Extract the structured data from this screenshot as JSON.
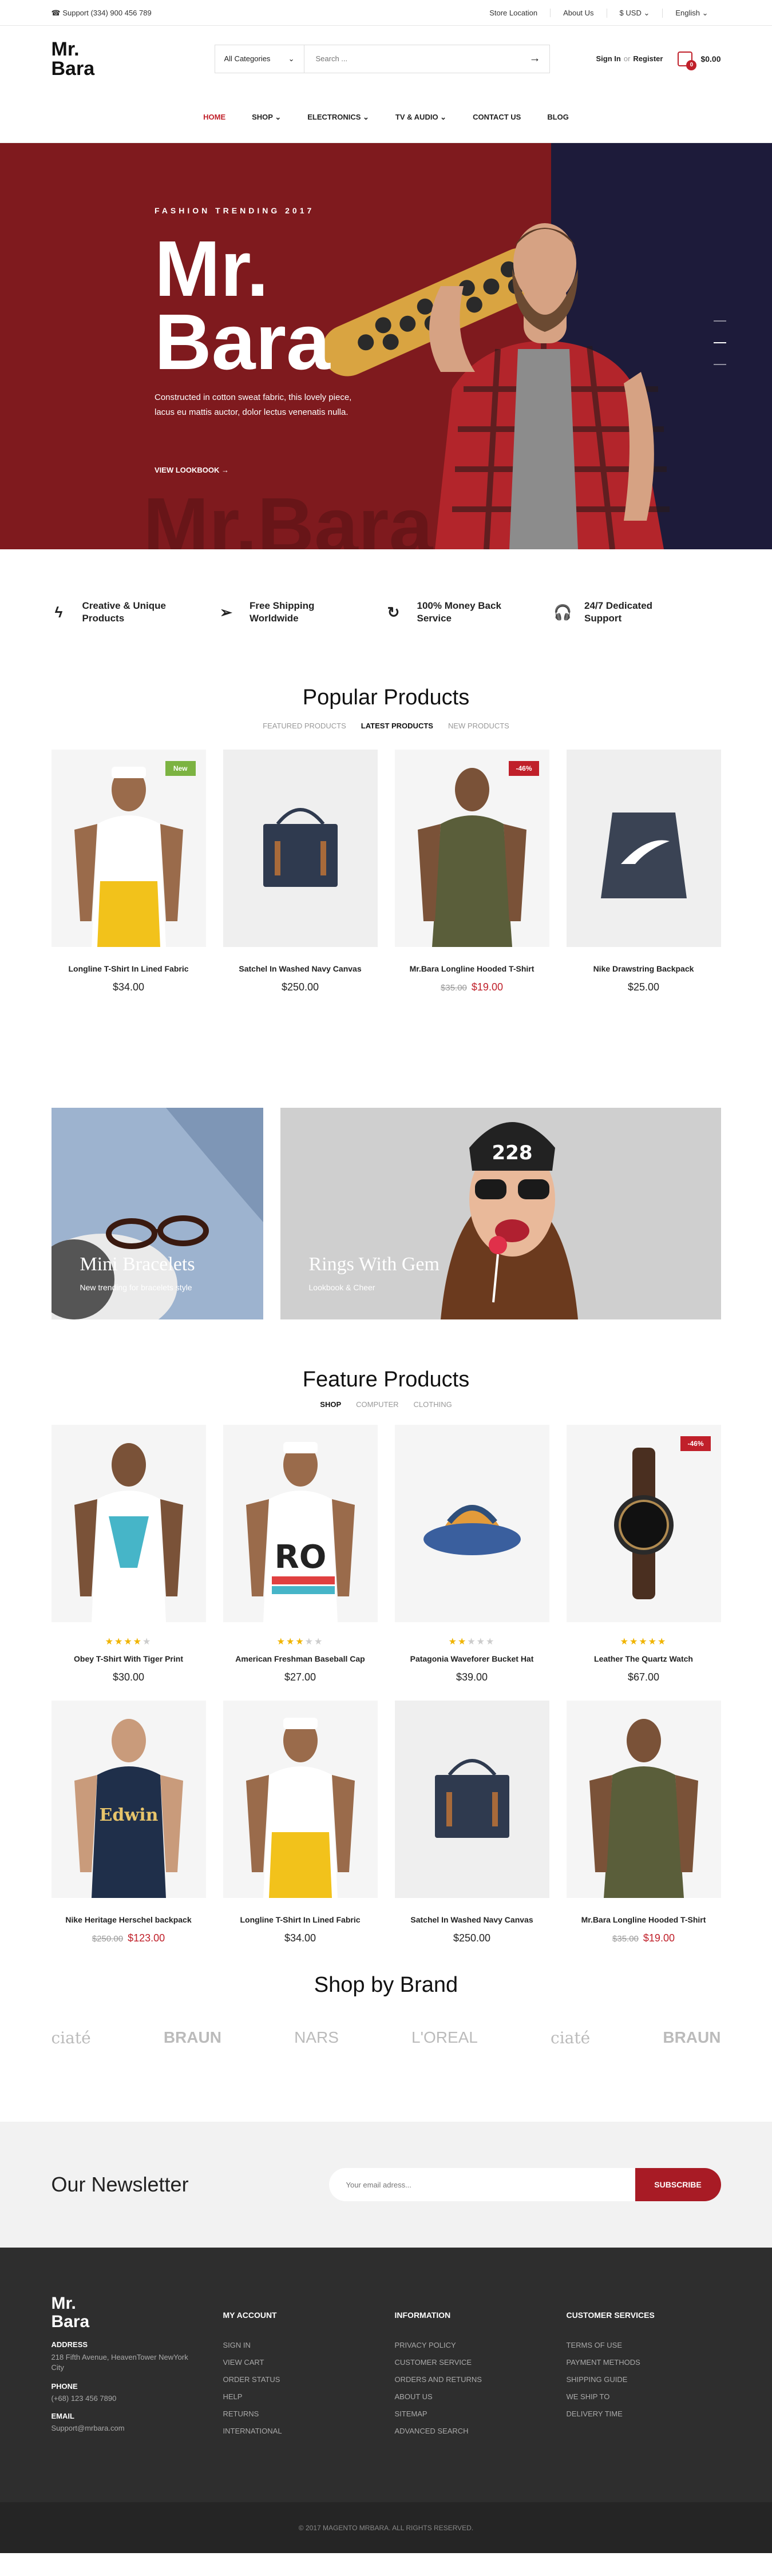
{
  "topbar": {
    "support": "Support (334) 900 456 789",
    "links": [
      "Store Location",
      "About Us",
      "$ USD ⌄",
      "English ⌄"
    ]
  },
  "header": {
    "logo": "Mr.\nBara",
    "category": "All Categories",
    "search_placeholder": "Search ...",
    "signin": "Sign In",
    "or": "or",
    "register": "Register",
    "cart_count": "0",
    "cart_total": "$0.00"
  },
  "nav": {
    "items": [
      "HOME",
      "SHOP ⌄",
      "ELECTRONICS ⌄",
      "TV & AUDIO ⌄",
      "CONTACT US",
      "BLOG"
    ]
  },
  "hero": {
    "tag": "FASHION TRENDING 2017",
    "title": "Mr. Bara",
    "desc": "Constructed in cotton sweat fabric, this lovely piece, lacus eu mattis auctor, dolor lectus venenatis nulla.",
    "cta": "VIEW LOOKBOOK →",
    "ghost": "Mr.Bara"
  },
  "features": [
    "Creative & Unique Products",
    "Free Shipping Worldwide",
    "100% Money Back Service",
    "24/7 Dedicated Support"
  ],
  "popular": {
    "title": "Popular Products",
    "tabs": [
      "FEATURED PRODUCTS",
      "LATEST PRODUCTS",
      "NEW PRODUCTS"
    ],
    "items": [
      {
        "name": "Longline T-Shirt In Lined Fabric",
        "price": "$34.00",
        "badge": "New"
      },
      {
        "name": "Satchel In Washed Navy Canvas",
        "price": "$250.00"
      },
      {
        "name": "Mr.Bara Longline Hooded T-Shirt",
        "old": "$35.00",
        "price": "$19.00",
        "badge": "-46%"
      },
      {
        "name": "Nike Drawstring Backpack",
        "price": "$25.00"
      }
    ]
  },
  "banners": [
    {
      "title": "Mini Bracelets",
      "sub": "New trending for bracelets style"
    },
    {
      "title": "Rings With Gem",
      "sub": "Lookbook & Cheer"
    }
  ],
  "feature": {
    "title": "Feature Products",
    "tabs": [
      "SHOP",
      "COMPUTER",
      "CLOTHING"
    ],
    "items": [
      {
        "name": "Obey T-Shirt With Tiger Print",
        "price": "$30.00",
        "stars": 4
      },
      {
        "name": "American Freshman Baseball Cap",
        "price": "$27.00",
        "stars": 3
      },
      {
        "name": "Patagonia Waveforer Bucket Hat",
        "price": "$39.00",
        "stars": 2
      },
      {
        "name": "Leather The Quartz Watch",
        "price": "$67.00",
        "stars": 5,
        "badge": "-46%"
      },
      {
        "name": "Nike Heritage Herschel backpack",
        "old": "$250.00",
        "price": "$123.00"
      },
      {
        "name": "Longline T-Shirt In Lined Fabric",
        "price": "$34.00"
      },
      {
        "name": "Satchel In Washed Navy Canvas",
        "price": "$250.00"
      },
      {
        "name": "Mr.Bara Longline Hooded T-Shirt",
        "old": "$35.00",
        "price": "$19.00"
      }
    ]
  },
  "brands": {
    "title": "Shop by Brand",
    "items": [
      "ciaté",
      "BRAUN",
      "NARS",
      "L'OREAL",
      "ciaté",
      "BRAUN"
    ]
  },
  "newsletter": {
    "title": "Our Newsletter",
    "placeholder": "Your email adress...",
    "button": "SUBSCRIBE"
  },
  "footer": {
    "logo": "Mr.\nBara",
    "address_label": "ADDRESS",
    "address": "218 Fifth Avenue, HeavenTower NewYork City",
    "phone_label": "PHONE",
    "phone": "(+68) 123 456 7890",
    "email_label": "EMAIL",
    "email": "Support@mrbara.com",
    "cols": [
      {
        "title": "MY ACCOUNT",
        "items": [
          "SIGN IN",
          "VIEW CART",
          "ORDER STATUS",
          "HELP",
          "RETURNS",
          "INTERNATIONAL"
        ]
      },
      {
        "title": "INFORMATION",
        "items": [
          "PRIVACY POLICY",
          "CUSTOMER SERVICE",
          "ORDERS AND RETURNS",
          "ABOUT US",
          "SITEMAP",
          "ADVANCED SEARCH"
        ]
      },
      {
        "title": "CUSTOMER SERVICES",
        "items": [
          "TERMS OF USE",
          "PAYMENT METHODS",
          "SHIPPING GUIDE",
          "WE SHIP TO",
          "DELIVERY TIME"
        ]
      }
    ],
    "copyright": "© 2017 MAGENTO MRBARA. ALL RIGHTS RESERVED."
  },
  "colors": {
    "accent": "#c0202a",
    "hero_red": "#7f1a1e",
    "hero_navy": "#1d1b3a",
    "footer": "#2e2e2e"
  }
}
